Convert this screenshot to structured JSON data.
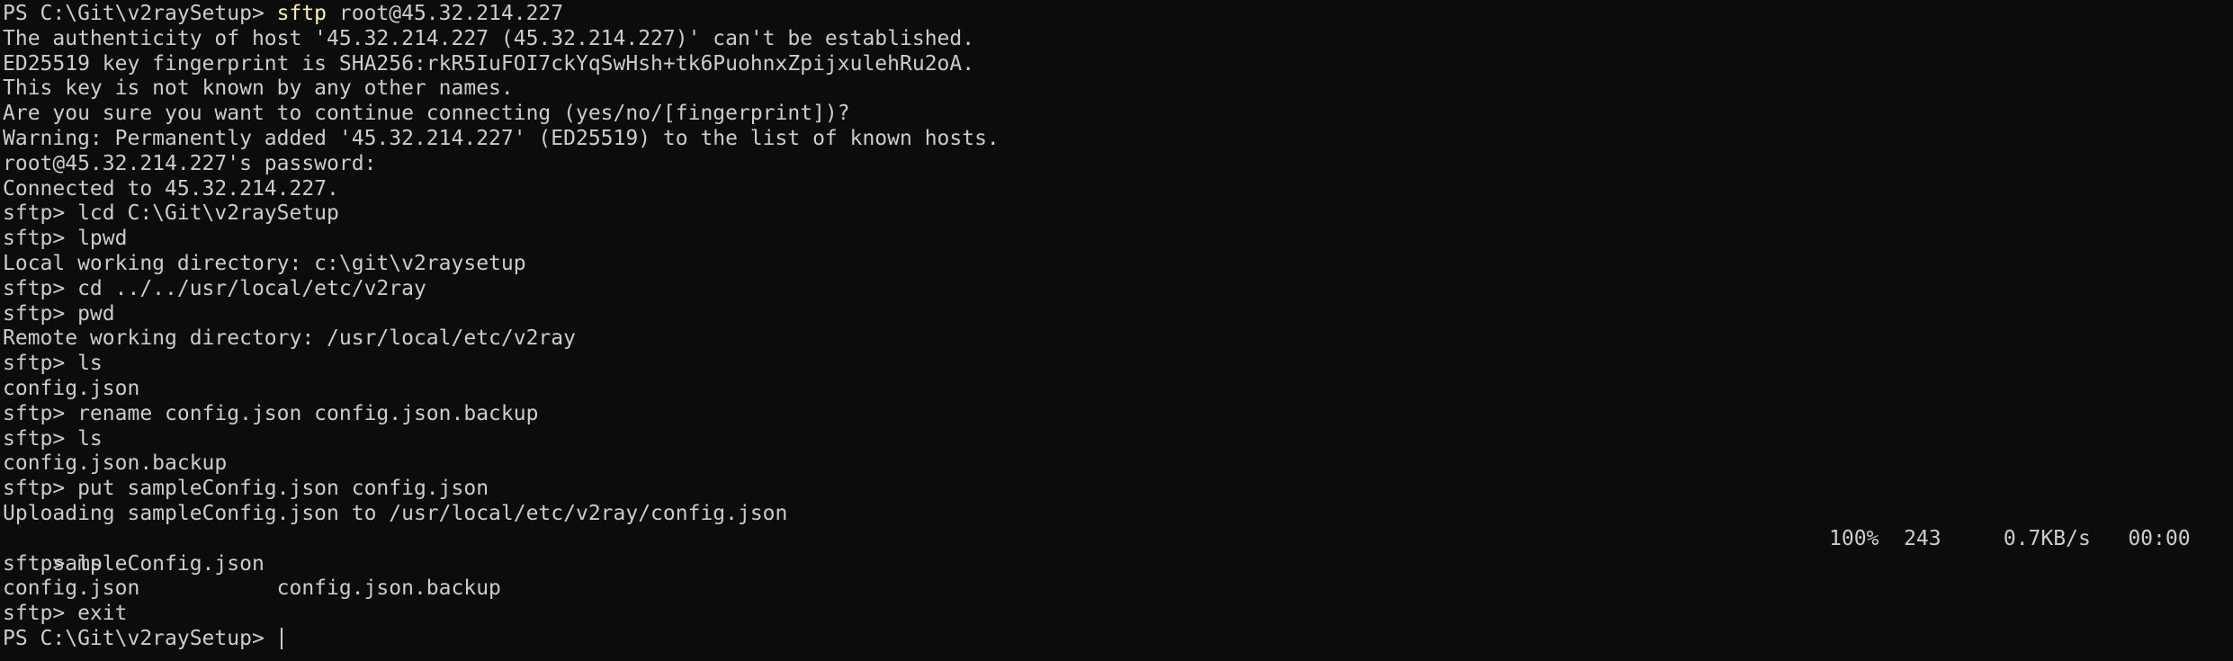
{
  "terminal": {
    "prompt_ps": "PS C:\\Git\\v2raySetup> ",
    "first_cmd_program": "sftp",
    "first_cmd_args": " root@45.32.214.227",
    "output_lines": [
      "The authenticity of host '45.32.214.227 (45.32.214.227)' can't be established.",
      "ED25519 key fingerprint is SHA256:rkR5IuFOI7ckYqSwHsh+tk6PuohnxZpijxulehRu2oA.",
      "This key is not known by any other names.",
      "Are you sure you want to continue connecting (yes/no/[fingerprint])?",
      "Warning: Permanently added '45.32.214.227' (ED25519) to the list of known hosts.",
      "root@45.32.214.227's password:",
      "Connected to 45.32.214.227.",
      "sftp> lcd C:\\Git\\v2raySetup",
      "sftp> lpwd",
      "Local working directory: c:\\git\\v2raysetup",
      "sftp> cd ../../usr/local/etc/v2ray",
      "sftp> pwd",
      "Remote working directory: /usr/local/etc/v2ray",
      "sftp> ls",
      "config.json",
      "sftp> rename config.json config.json.backup",
      "sftp> ls",
      "config.json.backup",
      "sftp> put sampleConfig.json config.json",
      "Uploading sampleConfig.json to /usr/local/etc/v2ray/config.json"
    ],
    "progress": {
      "file": "sampleConfig.json",
      "stats": "100%  243     0.7KB/s   00:00"
    },
    "tail_lines": [
      "sftp> ls",
      "config.json           config.json.backup",
      "sftp> exit"
    ],
    "final_prompt": "PS C:\\Git\\v2raySetup> "
  }
}
